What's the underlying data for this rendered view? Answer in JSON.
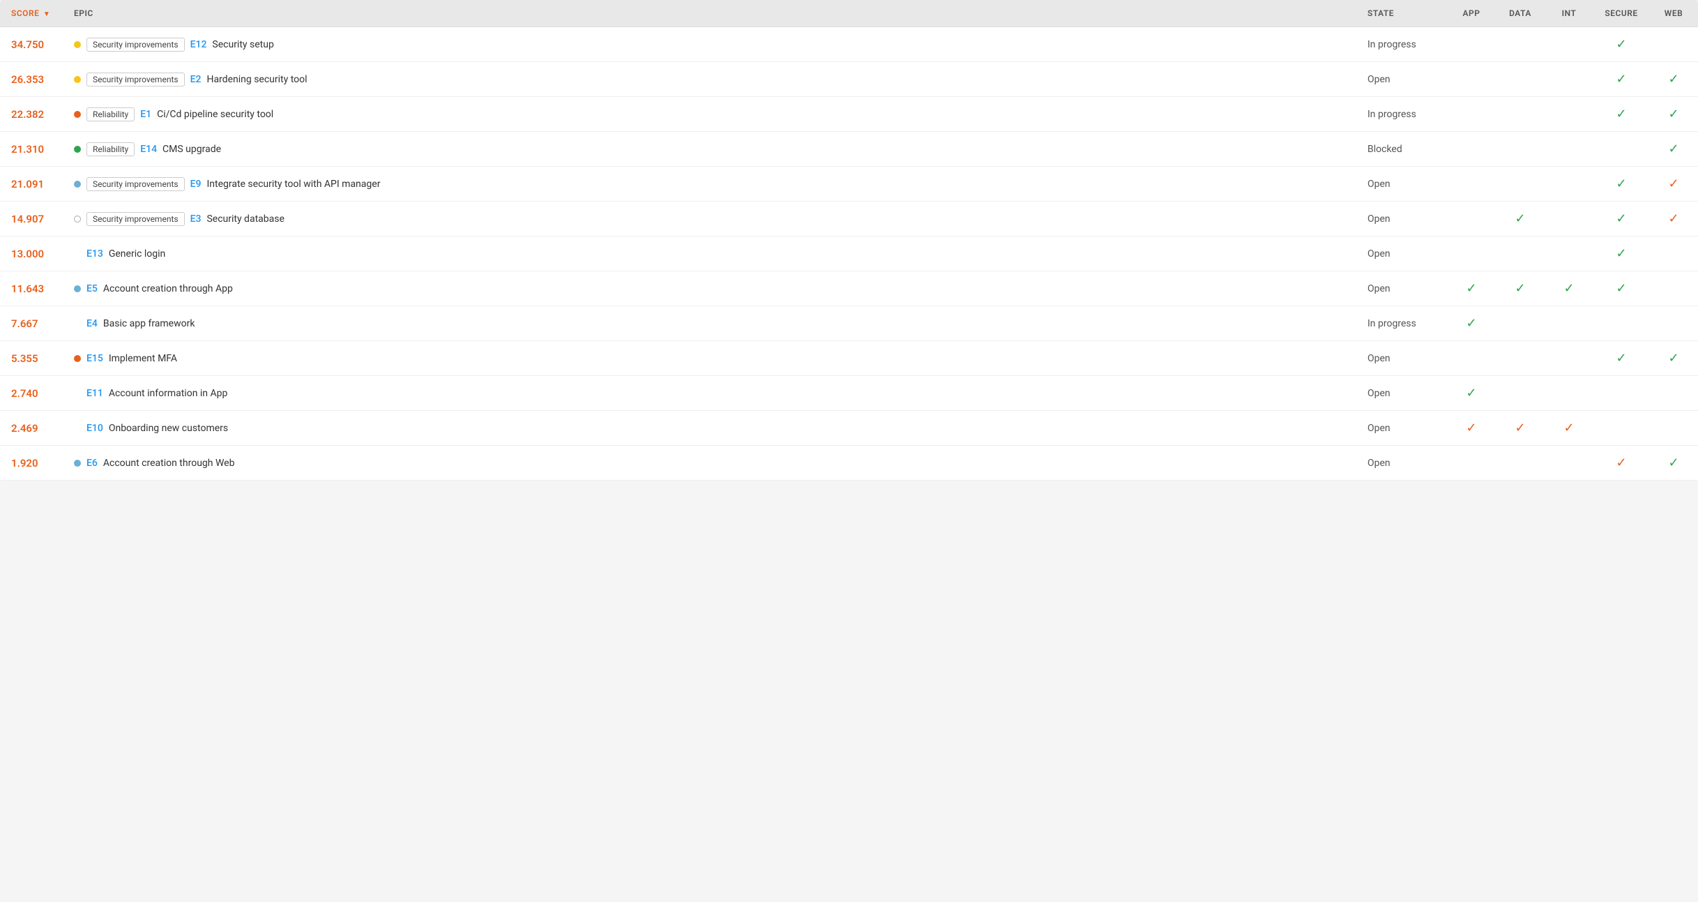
{
  "header": {
    "score_label": "SCORE",
    "epic_label": "EPIC",
    "state_label": "STATE",
    "app_label": "APP",
    "data_label": "DATA",
    "int_label": "INT",
    "secure_label": "SECURE",
    "web_label": "WEB"
  },
  "rows": [
    {
      "score": "34.750",
      "dot": "yellow",
      "tag": "Security improvements",
      "epic_id": "E12",
      "epic_name": "Security setup",
      "state": "In progress",
      "app": "",
      "data": "",
      "int": "",
      "secure": "green",
      "web": ""
    },
    {
      "score": "26.353",
      "dot": "yellow",
      "tag": "Security improvements",
      "epic_id": "E2",
      "epic_name": "Hardening security tool",
      "state": "Open",
      "app": "",
      "data": "",
      "int": "",
      "secure": "green",
      "web": "green"
    },
    {
      "score": "22.382",
      "dot": "orange",
      "tag": "Reliability",
      "epic_id": "E1",
      "epic_name": "Ci/Cd pipeline security tool",
      "state": "In progress",
      "app": "",
      "data": "",
      "int": "",
      "secure": "green",
      "web": "green"
    },
    {
      "score": "21.310",
      "dot": "green",
      "tag": "Reliability",
      "epic_id": "E14",
      "epic_name": "CMS upgrade",
      "state": "Blocked",
      "app": "",
      "data": "",
      "int": "",
      "secure": "",
      "web": "green"
    },
    {
      "score": "21.091",
      "dot": "blue",
      "tag": "Security improvements",
      "epic_id": "E9",
      "epic_name": "Integrate security tool with API manager",
      "state": "Open",
      "app": "",
      "data": "",
      "int": "",
      "secure": "green",
      "web": "orange"
    },
    {
      "score": "14.907",
      "dot": "empty",
      "tag": "Security improvements",
      "epic_id": "E3",
      "epic_name": "Security database",
      "state": "Open",
      "app": "",
      "data": "green",
      "int": "",
      "secure": "green",
      "web": "orange"
    },
    {
      "score": "13.000",
      "dot": "",
      "tag": "",
      "epic_id": "E13",
      "epic_name": "Generic login",
      "state": "Open",
      "app": "",
      "data": "",
      "int": "",
      "secure": "green",
      "web": ""
    },
    {
      "score": "11.643",
      "dot": "blue",
      "tag": "",
      "epic_id": "E5",
      "epic_name": "Account creation through App",
      "state": "Open",
      "app": "green",
      "data": "green",
      "int": "green",
      "secure": "green",
      "web": ""
    },
    {
      "score": "7.667",
      "dot": "",
      "tag": "",
      "epic_id": "E4",
      "epic_name": "Basic app framework",
      "state": "In progress",
      "app": "green",
      "data": "",
      "int": "",
      "secure": "",
      "web": ""
    },
    {
      "score": "5.355",
      "dot": "orange",
      "tag": "",
      "epic_id": "E15",
      "epic_name": "Implement MFA",
      "state": "Open",
      "app": "",
      "data": "",
      "int": "",
      "secure": "green",
      "web": "green"
    },
    {
      "score": "2.740",
      "dot": "",
      "tag": "",
      "epic_id": "E11",
      "epic_name": "Account information in App",
      "state": "Open",
      "app": "green",
      "data": "",
      "int": "",
      "secure": "",
      "web": ""
    },
    {
      "score": "2.469",
      "dot": "",
      "tag": "",
      "epic_id": "E10",
      "epic_name": "Onboarding new customers",
      "state": "Open",
      "app": "orange",
      "data": "orange",
      "int": "orange",
      "secure": "",
      "web": ""
    },
    {
      "score": "1.920",
      "dot": "blue",
      "tag": "",
      "epic_id": "E6",
      "epic_name": "Account creation through Web",
      "state": "Open",
      "app": "",
      "data": "",
      "int": "",
      "secure": "orange",
      "web": "green"
    }
  ],
  "icons": {
    "check": "✔",
    "sort_down": "▼"
  }
}
